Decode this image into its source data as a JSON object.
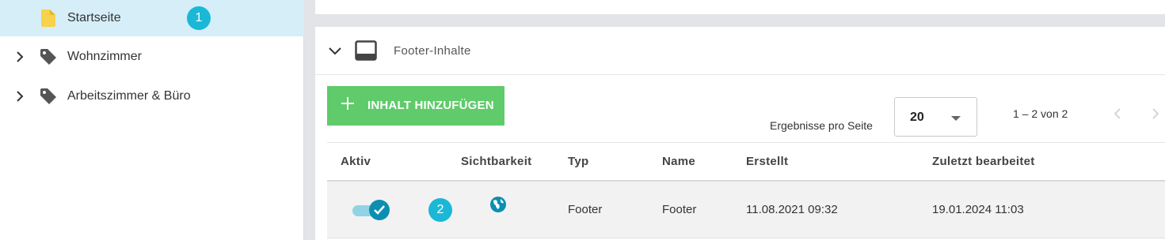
{
  "sidebar": {
    "items": [
      {
        "label": "Startseite",
        "icon": "page-icon",
        "active": true,
        "badge": "1"
      },
      {
        "label": "Wohnzimmer",
        "icon": "tag-icon",
        "active": false
      },
      {
        "label": "Arbeitszimmer & Büro",
        "icon": "tag-icon",
        "active": false
      }
    ]
  },
  "card": {
    "title": "Footer-Inhalte",
    "icon": "footer-layout-icon"
  },
  "toolbar": {
    "add_label": "INHALT HINZUFÜGEN",
    "per_page_label": "Ergebnisse pro Seite",
    "per_page_value": "20",
    "range": "1 – 2 von 2"
  },
  "table": {
    "headers": [
      "Aktiv",
      "Sichtbarkeit",
      "Typ",
      "Name",
      "Erstellt",
      "Zuletzt bearbeitet"
    ],
    "rows": [
      {
        "active": true,
        "badge": "2",
        "visibility": "globe-icon",
        "type": "Footer",
        "name": "Footer",
        "created": "11.08.2021 09:32",
        "modified": "19.01.2024 11:03"
      }
    ]
  },
  "colors": {
    "accent": "#1ab8d6",
    "add_button": "#5fcb6a",
    "active_row": "#d5eef8",
    "toggle": "#0b8fb0"
  }
}
